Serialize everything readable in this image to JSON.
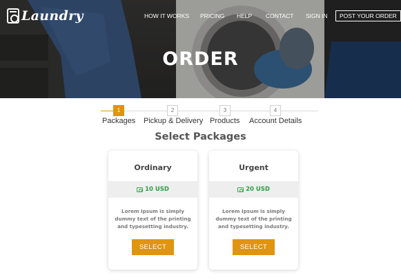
{
  "brand": {
    "logo_text": "Laundry"
  },
  "nav": {
    "items": [
      "HOW IT WORKS",
      "PRICING",
      "HELP",
      "CONTACT",
      "SIGN IN"
    ],
    "cta": "POST YOUR ORDER"
  },
  "hero": {
    "title": "ORDER"
  },
  "stepper": {
    "steps": [
      {
        "num": "1",
        "label": "Packages"
      },
      {
        "num": "2",
        "label": "Pickup & Delivery"
      },
      {
        "num": "3",
        "label": "Products"
      },
      {
        "num": "4",
        "label": "Account Details"
      }
    ],
    "active_step": 1
  },
  "section": {
    "title": "Select Packages"
  },
  "packages": [
    {
      "name": "Ordinary",
      "price": "10 USD",
      "description": "Lorem Ipsum is simply dummy text of the printing and typesetting industry.",
      "button": "SELECT"
    },
    {
      "name": "Urgent",
      "price": "20 USD",
      "description": "Lorem Ipsum is simply dummy text of the printing and typesetting industry.",
      "button": "SELECT"
    }
  ],
  "colors": {
    "accent": "#e0940f",
    "price_green": "#2e9e44",
    "hero_overlay": "#2e2d2c"
  },
  "icons": {
    "logo": "washing-machine-icon",
    "price": "money-icon"
  }
}
